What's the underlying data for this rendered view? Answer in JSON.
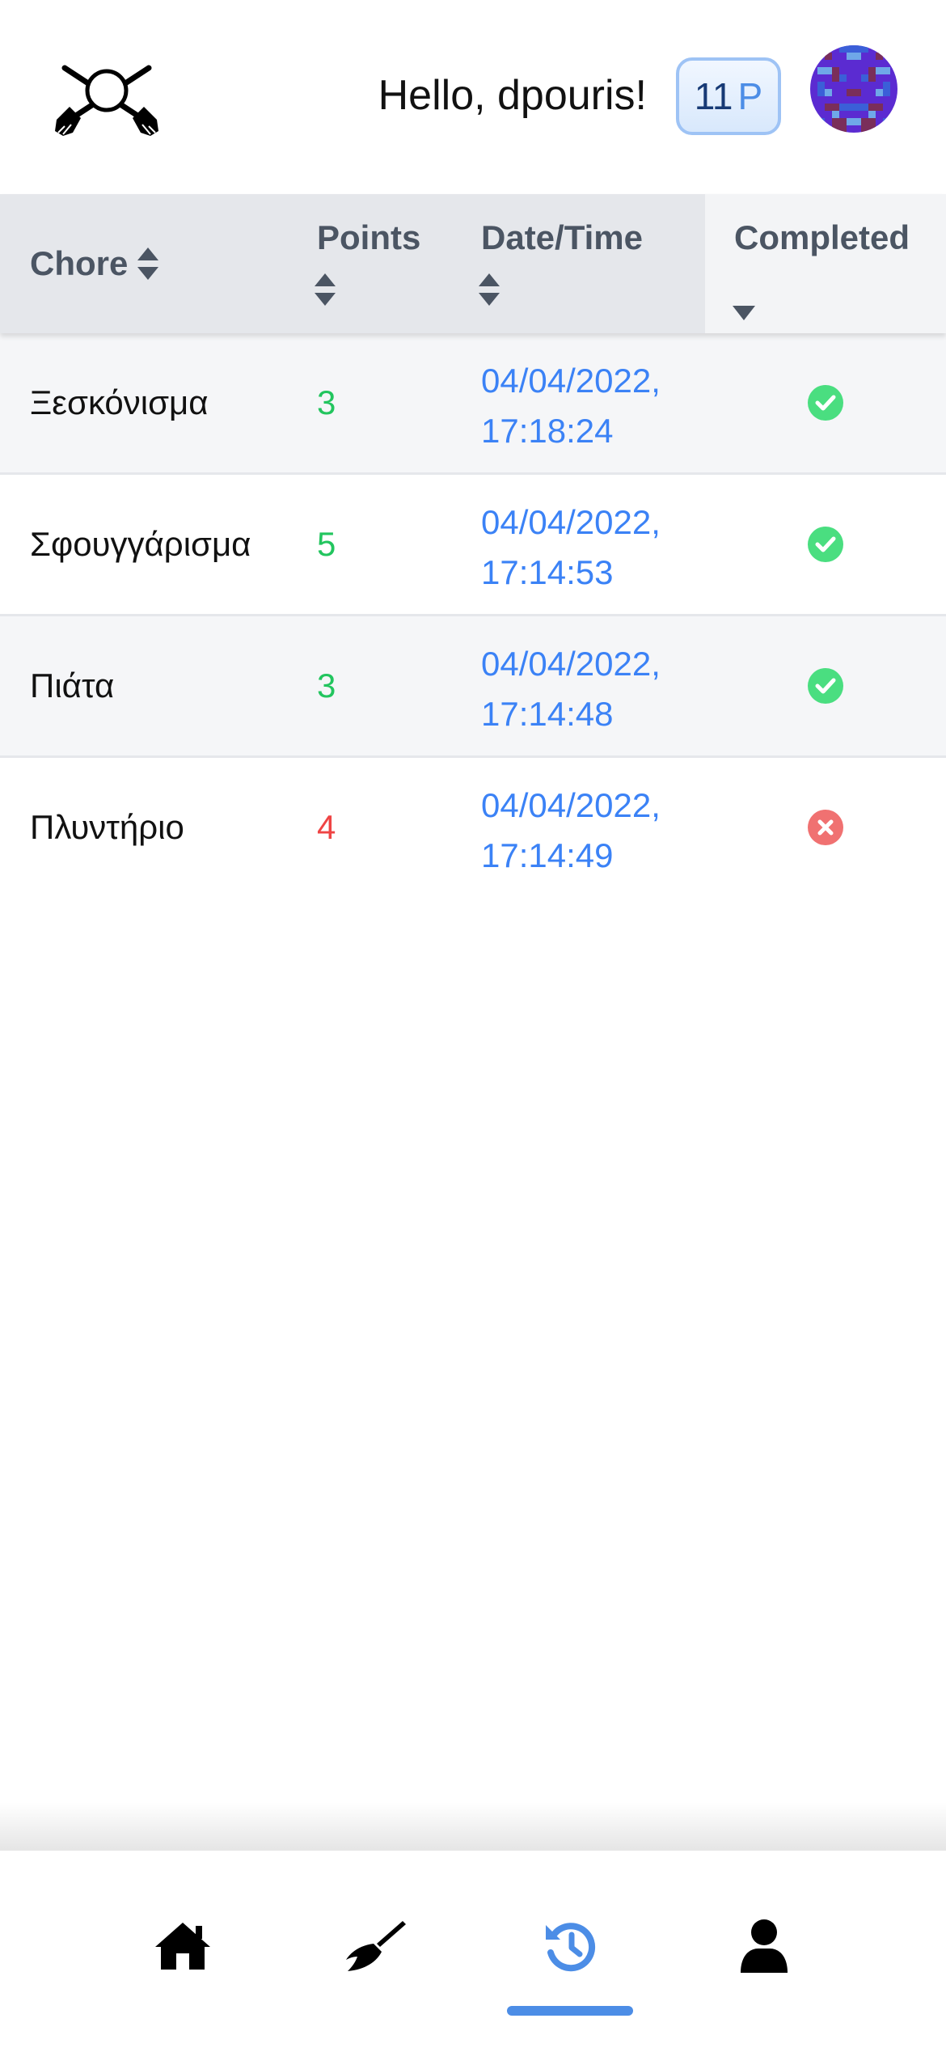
{
  "header": {
    "greeting": "Hello, dpouris!",
    "points_value": "11",
    "points_unit": "P",
    "logo_icon": "crossed-brooms-icon",
    "avatar_icon": "pixel-avatar"
  },
  "table": {
    "columns": [
      {
        "label": "Chore",
        "sort": "both"
      },
      {
        "label": "Points",
        "sort": "both"
      },
      {
        "label": "Date/Time",
        "sort": "both"
      },
      {
        "label": "Completed",
        "sort": "desc"
      }
    ],
    "rows": [
      {
        "chore": "Ξεσκόνισμα",
        "points": "3",
        "date": "04/04/2022,",
        "time": "17:18:24",
        "completed": true
      },
      {
        "chore": "Σφουγγάρισμα",
        "points": "5",
        "date": "04/04/2022,",
        "time": "17:14:53",
        "completed": true
      },
      {
        "chore": "Πιάτα",
        "points": "3",
        "date": "04/04/2022,",
        "time": "17:14:48",
        "completed": true
      },
      {
        "chore": "Πλυντήριο",
        "points": "4",
        "date": "04/04/2022,",
        "time": "17:14:49",
        "completed": false
      }
    ]
  },
  "nav": {
    "items": [
      {
        "icon": "home-icon",
        "active": false
      },
      {
        "icon": "broom-icon",
        "active": false
      },
      {
        "icon": "history-icon",
        "active": true
      },
      {
        "icon": "user-icon",
        "active": false
      }
    ]
  },
  "colors": {
    "positive": "#22c55e",
    "negative": "#ef4444",
    "accent": "#4c8de6",
    "date_text": "#3b82f6",
    "header_bg": "#e5e7eb",
    "completed_header_bg": "#f3f4f6"
  }
}
